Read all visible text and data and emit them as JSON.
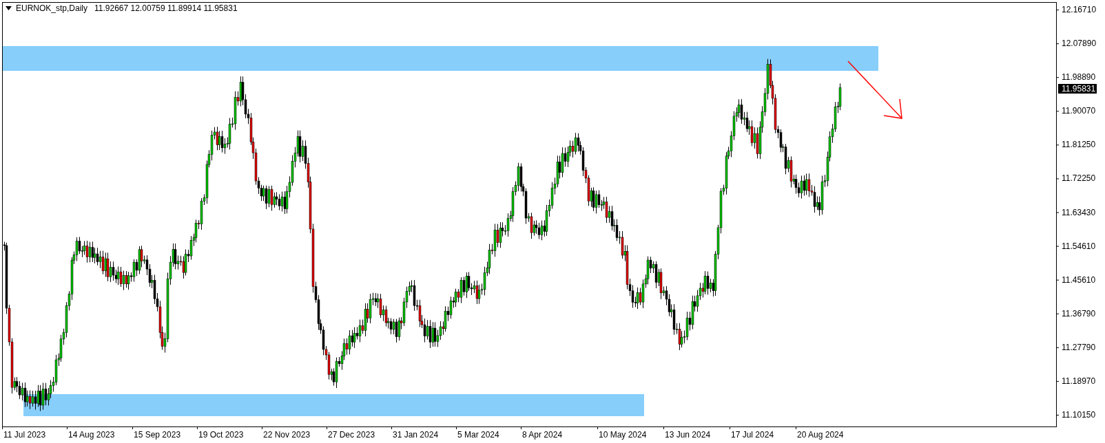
{
  "chart_header": {
    "symbol": "EURNOK_stp,Daily",
    "ohlc": "11.92667 12.00759 11.89914 11.95831"
  },
  "price_axis": [
    "12.16710",
    "12.07890",
    "11.98890",
    "11.90070",
    "11.81250",
    "11.72250",
    "11.63430",
    "11.54610",
    "11.45610",
    "11.36790",
    "11.27790",
    "11.18970",
    "11.10150"
  ],
  "current_price": "11.95831",
  "time_axis": [
    "11 Jul 2023",
    "14 Aug 2023",
    "15 Sep 2023",
    "19 Oct 2023",
    "22 Nov 2023",
    "27 Dec 2023",
    "31 Jan 2024",
    "5 Mar 2024",
    "8 Apr 2024",
    "10 May 2024",
    "13 Jun 2024",
    "17 Jul 2024",
    "20 Aug 2024"
  ]
}
